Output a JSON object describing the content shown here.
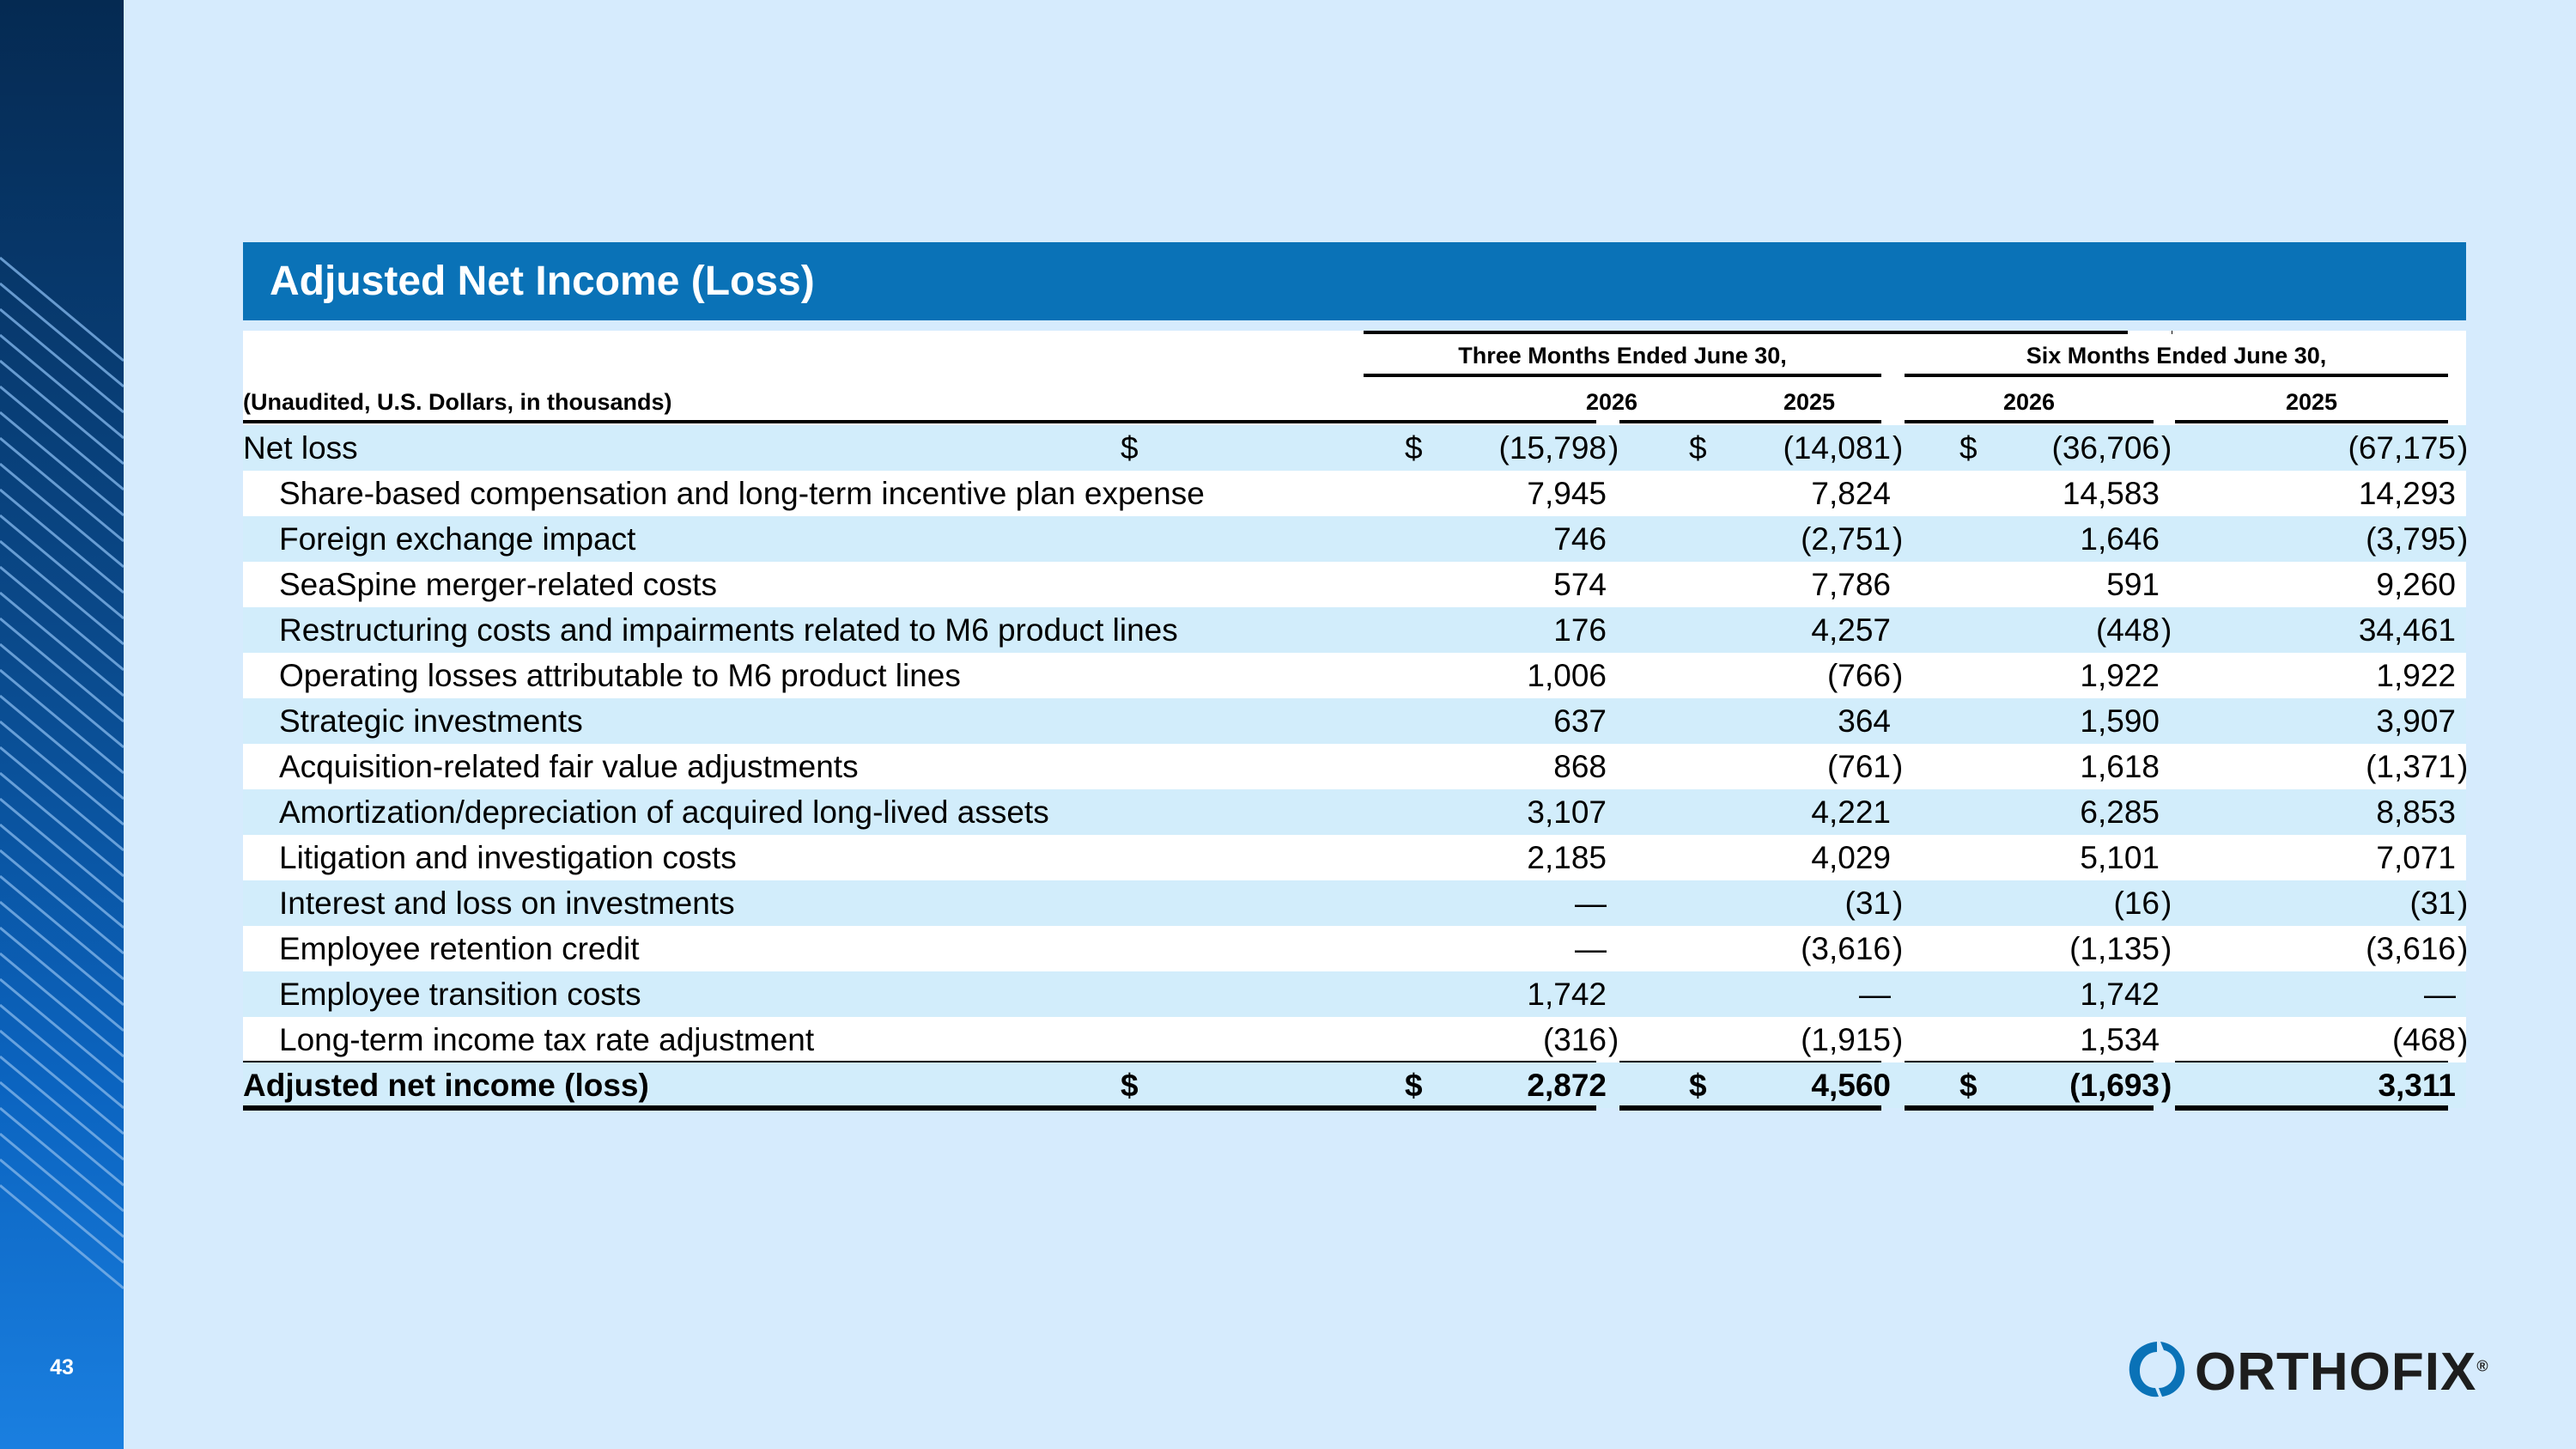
{
  "page": {
    "number": "43"
  },
  "banner": {
    "title": "Adjusted Net Income (Loss)"
  },
  "table": {
    "period_headers": [
      "Three Months Ended June 30,",
      "Six Months Ended June 30,"
    ],
    "units_label": "(Unaudited, U.S. Dollars, in thousands)",
    "years": [
      "2026",
      "2025",
      "2026",
      "2025"
    ],
    "currency_symbol": "$",
    "rows": [
      {
        "label": "Net loss",
        "values": [
          "(15,798",
          "(14,081",
          "(36,706",
          "(67,175"
        ],
        "close": [
          ")",
          ")",
          ")",
          ")"
        ]
      },
      {
        "label": "Share-based compensation and long-term incentive plan expense",
        "values": [
          "7,945",
          "7,824",
          "14,583",
          "14,293"
        ],
        "close": [
          "",
          "",
          "",
          ""
        ]
      },
      {
        "label": "Foreign exchange impact",
        "values": [
          "746",
          "(2,751",
          "1,646",
          "(3,795"
        ],
        "close": [
          "",
          ")",
          "",
          ")"
        ]
      },
      {
        "label": "SeaSpine merger-related costs",
        "values": [
          "574",
          "7,786",
          "591",
          "9,260"
        ],
        "close": [
          "",
          "",
          "",
          ""
        ]
      },
      {
        "label": "Restructuring costs and impairments related to M6 product lines",
        "values": [
          "176",
          "4,257",
          "(448",
          "34,461"
        ],
        "close": [
          "",
          "",
          ")",
          ""
        ]
      },
      {
        "label": "Operating losses attributable to M6 product lines",
        "values": [
          "1,006",
          "(766",
          "1,922",
          "1,922"
        ],
        "close": [
          "",
          ")",
          "",
          ""
        ]
      },
      {
        "label": "Strategic investments",
        "values": [
          "637",
          "364",
          "1,590",
          "3,907"
        ],
        "close": [
          "",
          "",
          "",
          ""
        ]
      },
      {
        "label": "Acquisition-related fair value adjustments",
        "values": [
          "868",
          "(761",
          "1,618",
          "(1,371"
        ],
        "close": [
          "",
          ")",
          "",
          ")"
        ]
      },
      {
        "label": "Amortization/depreciation of acquired long-lived assets",
        "values": [
          "3,107",
          "4,221",
          "6,285",
          "8,853"
        ],
        "close": [
          "",
          "",
          "",
          ""
        ]
      },
      {
        "label": "Litigation and investigation costs",
        "values": [
          "2,185",
          "4,029",
          "5,101",
          "7,071"
        ],
        "close": [
          "",
          "",
          "",
          ""
        ]
      },
      {
        "label": "Interest and loss on investments",
        "values": [
          "—",
          "(31",
          "(16",
          "(31"
        ],
        "close": [
          "",
          ")",
          ")",
          ")"
        ]
      },
      {
        "label": "Employee retention credit",
        "values": [
          "—",
          "(3,616",
          "(1,135",
          "(3,616"
        ],
        "close": [
          "",
          ")",
          ")",
          ")"
        ]
      },
      {
        "label": "Employee transition costs",
        "values": [
          "1,742",
          "—",
          "1,742",
          "—"
        ],
        "close": [
          "",
          "",
          "",
          ""
        ]
      },
      {
        "label": "Long-term income tax rate adjustment",
        "values": [
          "(316",
          "(1,915",
          "1,534",
          "(468"
        ],
        "close": [
          ")",
          ")",
          "",
          ")"
        ]
      }
    ],
    "total": {
      "label": "Adjusted net income (loss)",
      "values": [
        "2,872",
        "4,560",
        "(1,693",
        "3,311"
      ],
      "close": [
        "",
        "",
        ")",
        ""
      ]
    }
  },
  "logo": {
    "text": "ORTHOFIX",
    "mark": "®"
  },
  "colors": {
    "background": "#d6ebfd",
    "banner": "#0a72b7",
    "row_band": "#d2edfb"
  }
}
